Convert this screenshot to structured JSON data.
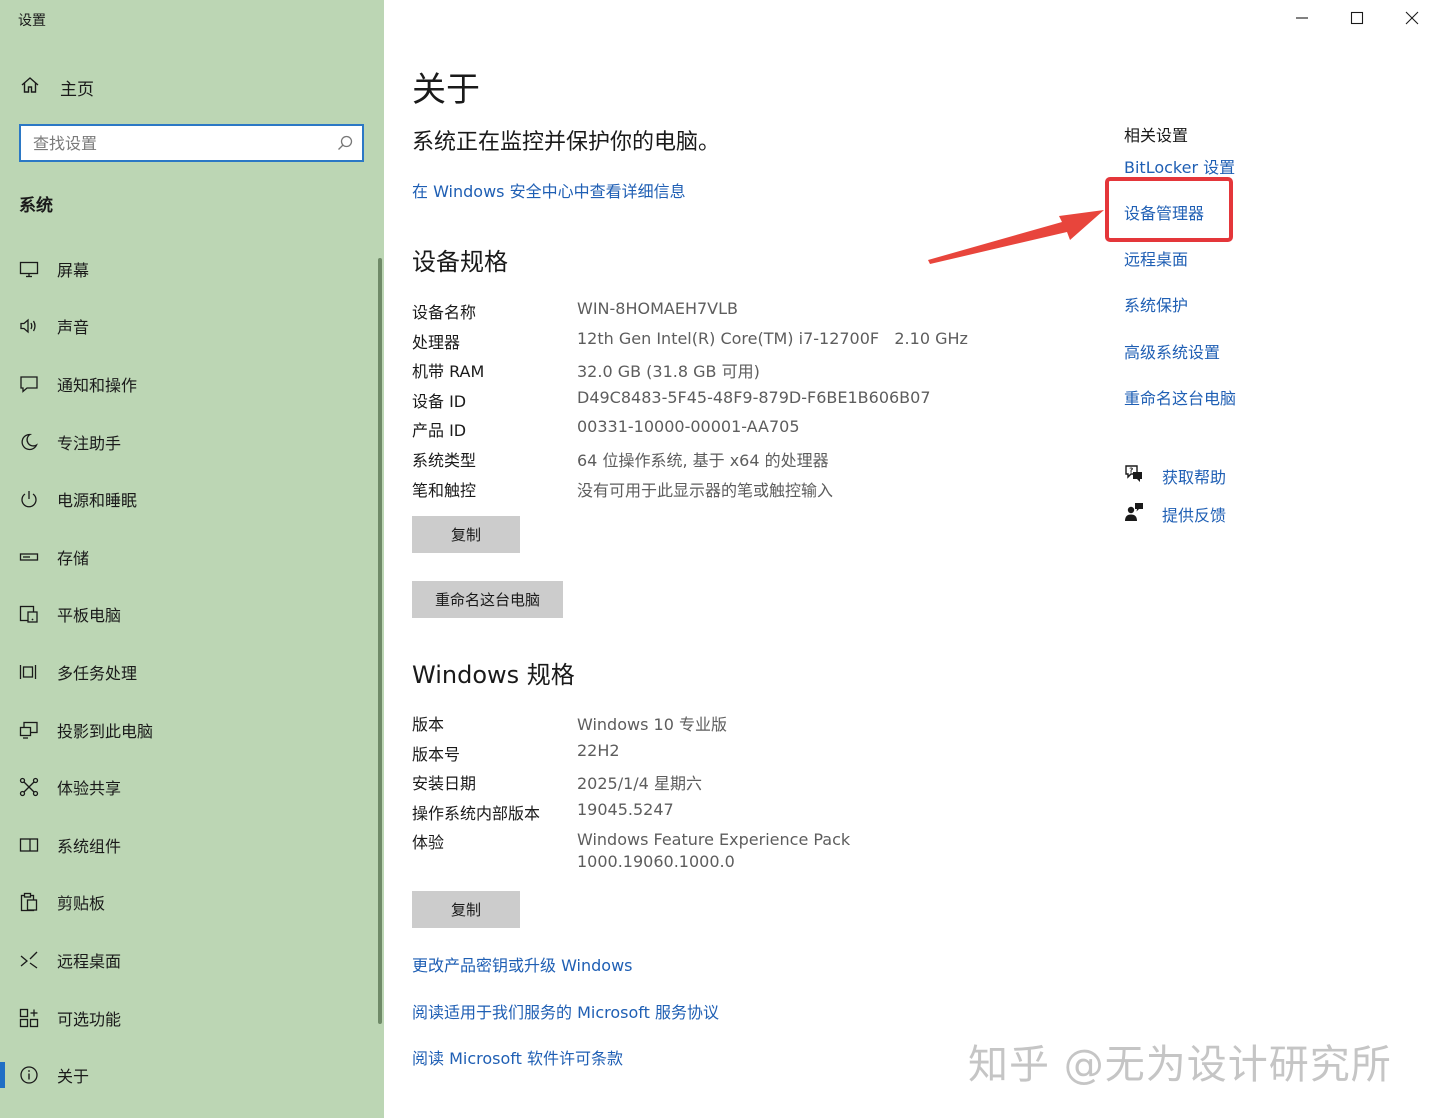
{
  "window": {
    "title": "设置",
    "controls": {
      "minimize": "minimize-icon",
      "maximize": "maximize-icon",
      "close": "close-icon"
    }
  },
  "sidebar": {
    "home_label": "主页",
    "search_placeholder": "查找设置",
    "section_label": "系统",
    "items": [
      {
        "label": "屏幕",
        "icon": "display-icon"
      },
      {
        "label": "声音",
        "icon": "speaker-icon"
      },
      {
        "label": "通知和操作",
        "icon": "notification-icon"
      },
      {
        "label": "专注助手",
        "icon": "moon-icon"
      },
      {
        "label": "电源和睡眠",
        "icon": "power-icon"
      },
      {
        "label": "存储",
        "icon": "storage-icon"
      },
      {
        "label": "平板电脑",
        "icon": "tablet-icon"
      },
      {
        "label": "多任务处理",
        "icon": "multitask-icon"
      },
      {
        "label": "投影到此电脑",
        "icon": "project-icon"
      },
      {
        "label": "体验共享",
        "icon": "share-icon"
      },
      {
        "label": "系统组件",
        "icon": "components-icon"
      },
      {
        "label": "剪贴板",
        "icon": "clipboard-icon"
      },
      {
        "label": "远程桌面",
        "icon": "remote-desktop-icon"
      },
      {
        "label": "可选功能",
        "icon": "optional-features-icon"
      },
      {
        "label": "关于",
        "icon": "info-icon",
        "active": true
      }
    ]
  },
  "main": {
    "title": "关于",
    "protect_text": "系统正在监控并保护你的电脑。",
    "security_link": "在 Windows 安全中心中查看详细信息",
    "device_specs": {
      "heading": "设备规格",
      "rows": [
        {
          "key": "设备名称",
          "value": "WIN-8HOMAEH7VLB"
        },
        {
          "key": "处理器",
          "value": "12th Gen Intel(R) Core(TM) i7-12700F   2.10 GHz"
        },
        {
          "key": "机带 RAM",
          "value": "32.0 GB (31.8 GB 可用)"
        },
        {
          "key": "设备 ID",
          "value": "D49C8483-5F45-48F9-879D-F6BE1B606B07"
        },
        {
          "key": "产品 ID",
          "value": "00331-10000-00001-AA705"
        },
        {
          "key": "系统类型",
          "value": "64 位操作系统, 基于 x64 的处理器"
        },
        {
          "key": "笔和触控",
          "value": "没有可用于此显示器的笔或触控输入"
        }
      ],
      "copy_button": "复制",
      "rename_button": "重命名这台电脑"
    },
    "windows_specs": {
      "heading": "Windows 规格",
      "rows": [
        {
          "key": "版本",
          "value": "Windows 10 专业版"
        },
        {
          "key": "版本号",
          "value": "22H2"
        },
        {
          "key": "安装日期",
          "value": "2025/1/4 星期六"
        },
        {
          "key": "操作系统内部版本",
          "value": "19045.5247"
        },
        {
          "key": "体验",
          "value": "Windows Feature Experience Pack\n1000.19060.1000.0"
        }
      ],
      "copy_button": "复制"
    },
    "links": {
      "product_key": "更改产品密钥或升级 Windows",
      "service_agreement": "阅读适用于我们服务的 Microsoft 服务协议",
      "license_terms": "阅读 Microsoft 软件许可条款"
    }
  },
  "related": {
    "title": "相关设置",
    "links": [
      "BitLocker 设置",
      "设备管理器",
      "远程桌面",
      "系统保护",
      "高级系统设置",
      "重命名这台电脑"
    ],
    "help_label": "获取帮助",
    "feedback_label": "提供反馈"
  },
  "annotation": {
    "highlight_color": "#e4363a",
    "target": "设备管理器"
  },
  "watermark": "知乎 @无为设计研究所",
  "colors": {
    "sidebar_bg": "#bcd6b4",
    "link": "#1f5fb4",
    "accent": "#1f6fc5",
    "button_bg": "#cccccc"
  }
}
